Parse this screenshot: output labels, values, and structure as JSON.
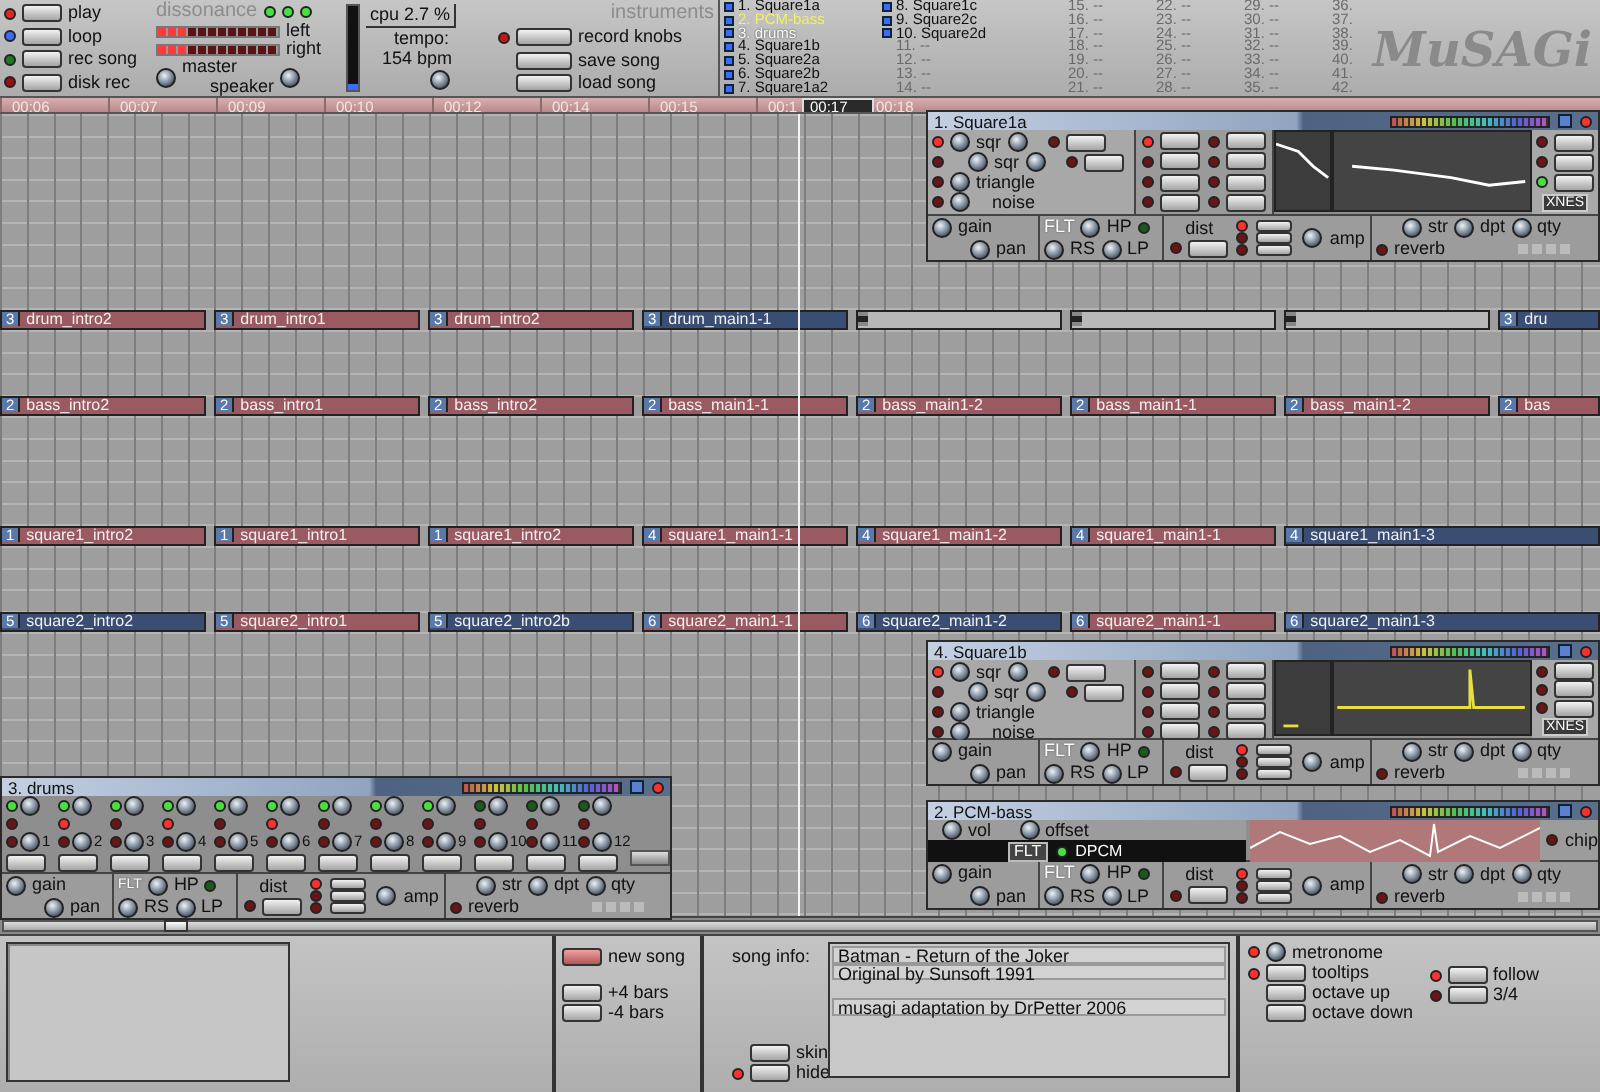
{
  "transport": [
    {
      "label": "play",
      "color": "#e02828"
    },
    {
      "label": "loop",
      "color": "#3a6cff"
    },
    {
      "label": "rec song",
      "color": "#1e7a1e"
    },
    {
      "label": "disk rec",
      "color": "#9a1010"
    }
  ],
  "mixer": {
    "dissonance": "dissonance",
    "meters": [
      {
        "label": "left",
        "level": 0.25
      },
      {
        "label": "right",
        "level": 0.25
      }
    ],
    "master": "master",
    "speaker": "speaker"
  },
  "cpu": {
    "label": "cpu 2.7 %",
    "level": 0.08
  },
  "tempo": {
    "label": "tempo:",
    "value": "154 bpm"
  },
  "song_buttons": [
    {
      "label": "record knobs",
      "led": true
    },
    {
      "label": "save song"
    },
    {
      "label": "load song"
    }
  ],
  "instruments": {
    "title": "instruments",
    "items": [
      {
        "kind": "instrument",
        "label": "1. Square1a",
        "selected": false,
        "highlighted": false
      },
      {
        "kind": "instrument",
        "label": "2. PCM-bass",
        "selected": false,
        "highlighted": true
      },
      {
        "kind": "instrument",
        "label": "3. drums",
        "selected": true,
        "highlighted": false
      },
      {
        "kind": "instrument",
        "label": "4. Square1b",
        "selected": false,
        "highlighted": false
      },
      {
        "kind": "instrument",
        "label": "5. Square2a",
        "selected": false,
        "highlighted": false
      },
      {
        "kind": "instrument",
        "label": "6. Square2b",
        "selected": false,
        "highlighted": false
      },
      {
        "kind": "instrument",
        "label": "7. Square1a2",
        "selected": false,
        "highlighted": false
      },
      {
        "kind": "instrument",
        "label": "8. Square1c",
        "selected": false,
        "highlighted": false
      },
      {
        "kind": "instrument",
        "label": "9. Square2c",
        "selected": false,
        "highlighted": false
      },
      {
        "kind": "instrument",
        "label": "10. Square2d",
        "selected": false,
        "highlighted": false
      },
      {
        "kind": "empty",
        "label": "11. --"
      },
      {
        "kind": "empty",
        "label": "12. --"
      },
      {
        "kind": "empty",
        "label": "13. --"
      },
      {
        "kind": "empty",
        "label": "14. --"
      },
      {
        "kind": "empty",
        "label": "15. --"
      },
      {
        "kind": "empty",
        "label": "16. --"
      },
      {
        "kind": "empty",
        "label": "17. --"
      },
      {
        "kind": "empty",
        "label": "18. --"
      },
      {
        "kind": "empty",
        "label": "19. --"
      },
      {
        "kind": "empty",
        "label": "20. --"
      },
      {
        "kind": "empty",
        "label": "21. --"
      },
      {
        "kind": "empty",
        "label": "22. --"
      },
      {
        "kind": "empty",
        "label": "23. --"
      },
      {
        "kind": "empty",
        "label": "24. --"
      },
      {
        "kind": "empty",
        "label": "25. --"
      },
      {
        "kind": "empty",
        "label": "26. --"
      },
      {
        "kind": "empty",
        "label": "27. --"
      },
      {
        "kind": "empty",
        "label": "28. --"
      },
      {
        "kind": "empty",
        "label": "29. --"
      },
      {
        "kind": "empty",
        "label": "30. --"
      },
      {
        "kind": "empty",
        "label": "31. --"
      },
      {
        "kind": "empty",
        "label": "32. --"
      },
      {
        "kind": "empty",
        "label": "33. --"
      },
      {
        "kind": "empty",
        "label": "34. --"
      },
      {
        "kind": "empty",
        "label": "35. --"
      },
      {
        "kind": "empty",
        "label": "36."
      },
      {
        "kind": "empty",
        "label": "37."
      },
      {
        "kind": "empty",
        "label": "38."
      },
      {
        "kind": "empty",
        "label": "39."
      },
      {
        "kind": "empty",
        "label": "40."
      },
      {
        "kind": "empty",
        "label": "41."
      },
      {
        "kind": "empty",
        "label": "42."
      }
    ]
  },
  "logo": "MuSAGi",
  "timeline": {
    "ticks": [
      "00:06",
      "00:07",
      "00:09",
      "00:10",
      "00:12",
      "00:14",
      "00:15",
      "00:1",
      "00:18"
    ],
    "cursor": "00:17"
  },
  "tracks": [
    {
      "blocks": [
        {
          "kind": "pattern",
          "number": "3",
          "name": "drum_intro2",
          "color": "#9a5a62"
        },
        {
          "kind": "pattern",
          "number": "3",
          "name": "drum_intro1",
          "color": "#9a5a62"
        },
        {
          "kind": "pattern",
          "number": "3",
          "name": "drum_intro2",
          "color": "#9a5a62"
        },
        {
          "kind": "pattern",
          "number": "3",
          "name": "drum_main1-1",
          "color": "#3a4e74"
        },
        {
          "kind": "continuation"
        },
        {
          "kind": "continuation"
        },
        {
          "kind": "continuation"
        },
        {
          "kind": "pattern",
          "number": "3",
          "name": "dru",
          "color": "#3a4e74"
        }
      ]
    },
    {
      "blocks": [
        {
          "kind": "pattern",
          "number": "2",
          "name": "bass_intro2",
          "color": "#9a5a62"
        },
        {
          "kind": "pattern",
          "number": "2",
          "name": "bass_intro1",
          "color": "#9a5a62"
        },
        {
          "kind": "pattern",
          "number": "2",
          "name": "bass_intro2",
          "color": "#9a5a62"
        },
        {
          "kind": "pattern",
          "number": "2",
          "name": "bass_main1-1",
          "color": "#9a5a62"
        },
        {
          "kind": "pattern",
          "number": "2",
          "name": "bass_main1-2",
          "color": "#9a5a62"
        },
        {
          "kind": "pattern",
          "number": "2",
          "name": "bass_main1-1",
          "color": "#9a5a62"
        },
        {
          "kind": "pattern",
          "number": "2",
          "name": "bass_main1-2",
          "color": "#9a5a62"
        },
        {
          "kind": "pattern",
          "number": "2",
          "name": "bas",
          "color": "#9a5a62"
        }
      ]
    },
    {
      "blocks": [
        {
          "kind": "pattern",
          "number": "1",
          "name": "square1_intro2",
          "color": "#9a5a62"
        },
        {
          "kind": "pattern",
          "number": "1",
          "name": "square1_intro1",
          "color": "#9a5a62"
        },
        {
          "kind": "pattern",
          "number": "1",
          "name": "square1_intro2",
          "color": "#9a5a62"
        },
        {
          "kind": "pattern",
          "number": "4",
          "name": "square1_main1-1",
          "color": "#9a5a62"
        },
        {
          "kind": "pattern",
          "number": "4",
          "name": "square1_main1-2",
          "color": "#9a5a62"
        },
        {
          "kind": "pattern",
          "number": "4",
          "name": "square1_main1-1",
          "color": "#9a5a62"
        },
        {
          "kind": "pattern",
          "number": "4",
          "name": "square1_main1-3",
          "color": "#3a4e74"
        }
      ]
    },
    {
      "blocks": [
        {
          "kind": "pattern",
          "number": "5",
          "name": "square2_intro2",
          "color": "#3a4e74"
        },
        {
          "kind": "pattern",
          "number": "5",
          "name": "square2_intro1",
          "color": "#9a5a62"
        },
        {
          "kind": "pattern",
          "number": "5",
          "name": "square2_intro2b",
          "color": "#3a4e74"
        },
        {
          "kind": "pattern",
          "number": "6",
          "name": "square2_main1-1",
          "color": "#9a5a62"
        },
        {
          "kind": "pattern",
          "number": "6",
          "name": "square2_main1-2",
          "color": "#3a4e74"
        },
        {
          "kind": "pattern",
          "number": "6",
          "name": "square2_main1-1",
          "color": "#9a5a62"
        },
        {
          "kind": "pattern",
          "number": "6",
          "name": "square2_main1-3",
          "color": "#3a4e74"
        }
      ]
    }
  ],
  "windows": [
    {
      "kind": "square",
      "title": "1. Square1a",
      "color": "#ffffff",
      "oscillators": [
        "sqr",
        "sqr",
        "triangle",
        "noise"
      ],
      "badge": "XNES",
      "effects": {
        "gain": "gain",
        "pan": "pan",
        "filter": "FLT",
        "hp": "HP",
        "rs": "RS",
        "lp": "LP",
        "dist": "dist",
        "amp": "amp",
        "str": "str",
        "dpt": "dpt",
        "qty": "qty",
        "reverb": "reverb"
      }
    },
    {
      "kind": "square",
      "title": "4. Square1b",
      "color": "#e8e040",
      "oscillators": [
        "sqr",
        "sqr",
        "triangle",
        "noise"
      ],
      "badge": "XNES",
      "effects": {
        "gain": "gain",
        "pan": "pan",
        "filter": "FLT",
        "hp": "HP",
        "rs": "RS",
        "lp": "LP",
        "dist": "dist",
        "amp": "amp",
        "str": "str",
        "dpt": "dpt",
        "qty": "qty",
        "reverb": "reverb"
      }
    },
    {
      "kind": "drums",
      "title": "3. drums",
      "channels": [
        {
          "label": "1",
          "active": true,
          "accent": false
        },
        {
          "label": "2",
          "active": true,
          "accent": true
        },
        {
          "label": "3",
          "active": true,
          "accent": false
        },
        {
          "label": "4",
          "active": true,
          "accent": true
        },
        {
          "label": "5",
          "active": true,
          "accent": false
        },
        {
          "label": "6",
          "active": true,
          "accent": true
        },
        {
          "label": "7",
          "active": true,
          "accent": false
        },
        {
          "label": "8",
          "active": true,
          "accent": false
        },
        {
          "label": "9",
          "active": true,
          "accent": false
        },
        {
          "label": "10",
          "active": false,
          "accent": false
        },
        {
          "label": "11",
          "active": false,
          "accent": false
        },
        {
          "label": "12",
          "active": false,
          "accent": false
        }
      ],
      "effects": {
        "gain": "gain",
        "pan": "pan",
        "filter": "FLT",
        "hp": "HP",
        "rs": "RS",
        "lp": "LP",
        "dist": "dist",
        "amp": "amp",
        "str": "str",
        "dpt": "dpt",
        "qty": "qty",
        "reverb": "reverb"
      }
    },
    {
      "kind": "pcm",
      "title": "2. PCM-bass",
      "color": "#ffffff",
      "knobs": [
        "vol",
        "offset"
      ],
      "filter": "FLT",
      "dpcm": "DPCM",
      "chip": "chip",
      "effects": {
        "gain": "gain",
        "pan": "pan",
        "filter": "FLT",
        "hp": "HP",
        "rs": "RS",
        "lp": "LP",
        "dist": "dist",
        "amp": "amp",
        "str": "str",
        "dpt": "dpt",
        "qty": "qty",
        "reverb": "reverb"
      }
    }
  ],
  "bottom": {
    "new_song": "new song",
    "plus_bars": "+4 bars",
    "minus_bars": "-4 bars",
    "song_info_label": "song info:",
    "skin": "skin",
    "hide": "hide",
    "hide_led": true,
    "song_info": [
      "Batman - Return of the Joker",
      "Original by Sunsoft 1991",
      "musagi adaptation by DrPetter 2006"
    ],
    "options": [
      {
        "label": "metronome",
        "kind": "knob",
        "led": true
      },
      {
        "label": "tooltips",
        "kind": "button",
        "led": true
      },
      {
        "label": "octave up",
        "kind": "button"
      },
      {
        "label": "octave down",
        "kind": "button"
      },
      {
        "label": "follow",
        "kind": "button",
        "led": true
      },
      {
        "label": "3/4",
        "kind": "button",
        "led": false
      }
    ]
  }
}
